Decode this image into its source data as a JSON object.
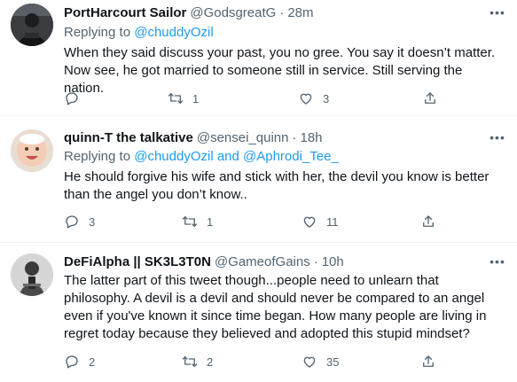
{
  "tweets": [
    {
      "name": "PortHarcourt Sailor",
      "handle": "@GodsgreatG",
      "dot": "·",
      "time": "28m",
      "replying_prefix": "Replying to",
      "replying_links": "@chuddyOzil",
      "text": "When they said discuss your past, you no gree. You say it doesn’t matter. Now see, he got married to someone still in service. Still serving the nation.",
      "replies": "",
      "retweets": "1",
      "likes": "3"
    },
    {
      "name": "quinn-T the talkative",
      "handle": "@sensei_quinn",
      "dot": "·",
      "time": "18h",
      "replying_prefix": "Replying to",
      "replying_links": "@chuddyOzil and @Aphrodi_Tee_",
      "text": "He should forgive his wife and stick with her, the devil you know is better than the angel you don’t know..",
      "replies": "3",
      "retweets": "1",
      "likes": "11"
    },
    {
      "name": "DeFiAlpha || SK3L3T0N",
      "handle": "@GameofGains",
      "dot": "·",
      "time": "10h",
      "replying_prefix": "",
      "replying_links": "",
      "text": "The latter part of this tweet though...people need to unlearn that philosophy. A devil is a devil and should never be compared to an angel even if you've known it since time began. How many people are living in regret today because they believed and adopted this stupid mindset?",
      "replies": "2",
      "retweets": "2",
      "likes": "35"
    }
  ],
  "icons": {
    "more": "more-icon",
    "reply": "reply-icon",
    "retweet": "retweet-icon",
    "like": "like-icon",
    "share": "share-icon"
  },
  "colors": {
    "link": "#1d9bf0",
    "secondary_text": "#536471",
    "divider": "#eff3f4"
  }
}
